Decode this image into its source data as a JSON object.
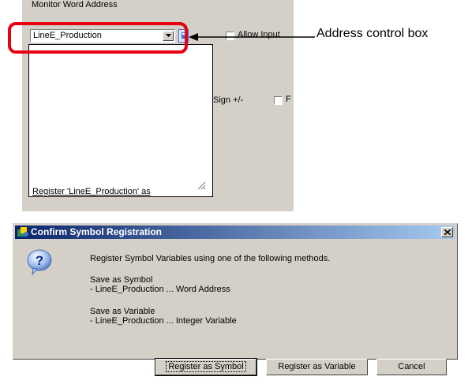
{
  "top_panel": {
    "section_label": "Monitor Word Address",
    "address_value": "LineE_Production",
    "allow_input_label": "Allow Input",
    "sign_label": "Sign +/-",
    "sign_checkbox_label": "F",
    "register_link": "Register 'LineE_Production' as"
  },
  "annotation": {
    "callout": "Address control box",
    "highlight_color": "#e60012"
  },
  "dialog": {
    "title": "Confirm Symbol Registration",
    "message": "Register Symbol Variables using one of the following methods.",
    "save_symbol_title": "Save as Symbol",
    "save_symbol_detail": "- LineE_Production ... Word Address",
    "save_variable_title": "Save as Variable",
    "save_variable_detail": "- LineE_Production ... Integer Variable",
    "buttons": {
      "register_symbol": "Register as Symbol",
      "register_variable": "Register as Variable",
      "cancel": "Cancel"
    },
    "titlebar_color": "#0a246a"
  }
}
